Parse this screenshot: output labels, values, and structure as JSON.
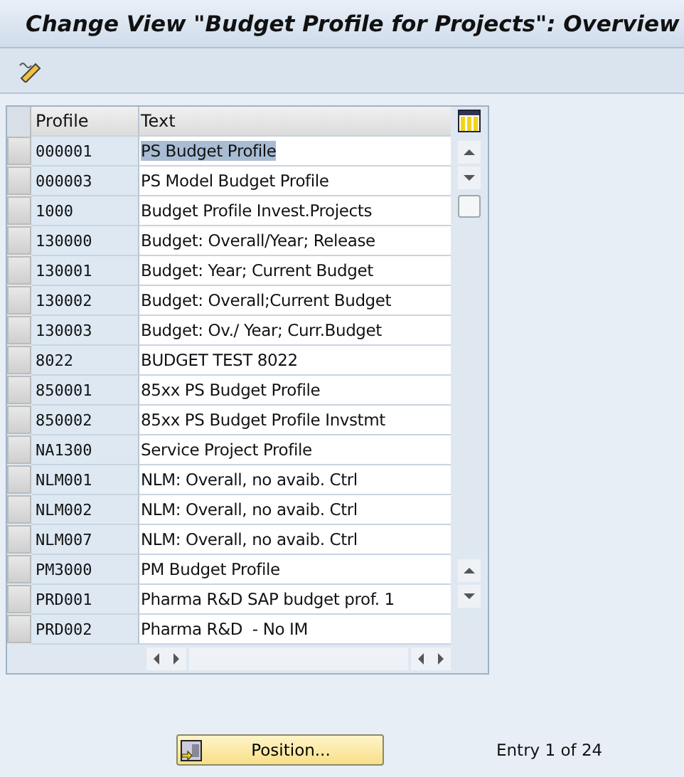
{
  "window": {
    "title": "Change View \"Budget Profile for Projects\": Overview"
  },
  "table": {
    "columns": [
      "Profile",
      "Text"
    ],
    "rows": [
      {
        "profile": "000001",
        "text": "PS Budget Profile",
        "selected": true
      },
      {
        "profile": "000003",
        "text": "PS Model Budget Profile",
        "selected": false
      },
      {
        "profile": "1000",
        "text": "Budget Profile Invest.Projects",
        "selected": false
      },
      {
        "profile": "130000",
        "text": "Budget: Overall/Year; Release",
        "selected": false
      },
      {
        "profile": "130001",
        "text": "Budget: Year; Current Budget",
        "selected": false
      },
      {
        "profile": "130002",
        "text": "Budget: Overall;Current Budget",
        "selected": false
      },
      {
        "profile": "130003",
        "text": "Budget: Ov./ Year; Curr.Budget",
        "selected": false
      },
      {
        "profile": "8022",
        "text": "BUDGET TEST 8022",
        "selected": false
      },
      {
        "profile": "850001",
        "text": "85xx PS Budget Profile",
        "selected": false
      },
      {
        "profile": "850002",
        "text": "85xx PS Budget Profile Invstmt",
        "selected": false
      },
      {
        "profile": "NA1300",
        "text": "Service Project Profile",
        "selected": false
      },
      {
        "profile": "NLM001",
        "text": "NLM: Overall, no avaib. Ctrl",
        "selected": false
      },
      {
        "profile": "NLM002",
        "text": "NLM: Overall, no avaib. Ctrl",
        "selected": false
      },
      {
        "profile": "NLM007",
        "text": "NLM: Overall, no avaib. Ctrl",
        "selected": false
      },
      {
        "profile": "PM3000",
        "text": "PM Budget Profile",
        "selected": false
      },
      {
        "profile": "PRD001",
        "text": "Pharma R&D SAP budget prof. 1",
        "selected": false
      },
      {
        "profile": "PRD002",
        "text": "Pharma R&D  - No IM",
        "selected": false
      }
    ]
  },
  "footer": {
    "button": "Position...",
    "entry": "Entry 1 of 24"
  }
}
